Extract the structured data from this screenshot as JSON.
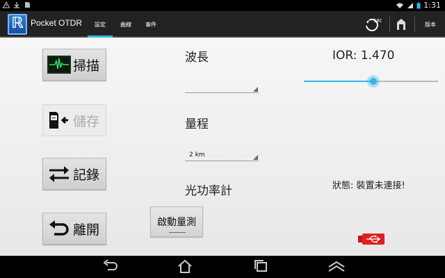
{
  "status_bar": {
    "time": "1:31",
    "icons": [
      "warning-icon",
      "download-icon",
      "sd-card-icon",
      "wifi-icon",
      "signal-icon",
      "battery-icon"
    ]
  },
  "action_bar": {
    "app_title": "Pocket OTDR",
    "tabs": [
      {
        "label": "設定",
        "active": true
      },
      {
        "label": "曲線",
        "active": false
      },
      {
        "label": "事件",
        "active": false
      }
    ],
    "rotate_label": "180",
    "version_label": "版本"
  },
  "main": {
    "buttons": [
      {
        "label": "掃描",
        "icon": "waveform-icon",
        "enabled": true
      },
      {
        "label": "儲存",
        "icon": "sd-save-icon",
        "enabled": false
      },
      {
        "label": "記錄",
        "icon": "swap-arrows-icon",
        "enabled": true
      },
      {
        "label": "離開",
        "icon": "back-arrow-icon",
        "enabled": true
      }
    ],
    "wavelength": {
      "label": "波長",
      "value": ""
    },
    "range": {
      "label": "量程",
      "value": "2 km"
    },
    "power_meter": {
      "label": "光功率計",
      "button_label": "啟動量測"
    },
    "ior": {
      "label": "IOR: 1.470",
      "slider_fraction": 0.52
    },
    "status": "狀態: 裝置未連接!"
  },
  "colors": {
    "accent": "#33b5e5",
    "action_bar": "#222222",
    "usb_icon": "#e02020"
  }
}
